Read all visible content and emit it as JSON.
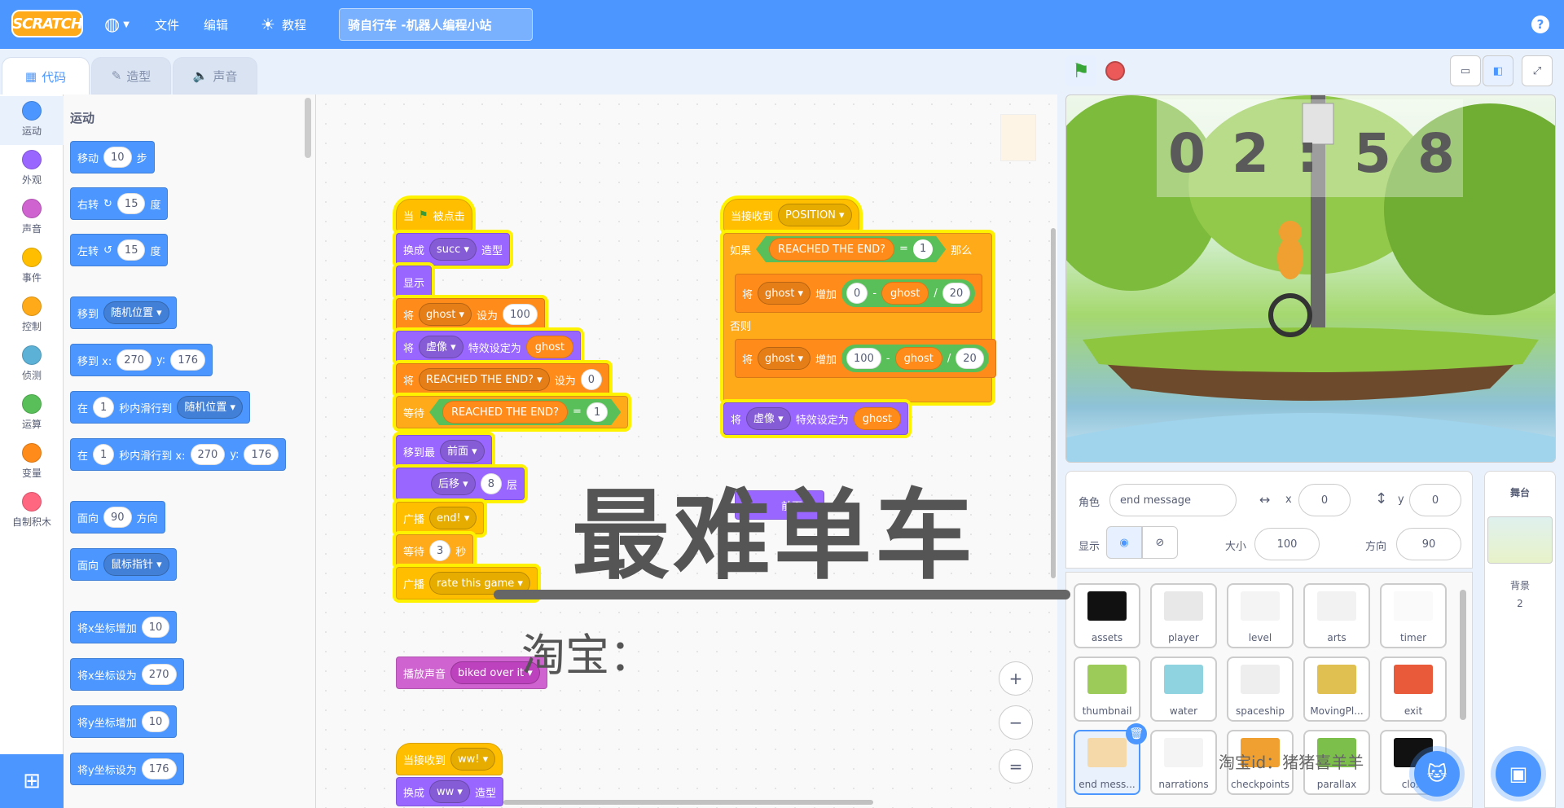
{
  "menubar": {
    "logo": "SCRATCH",
    "file": "文件",
    "edit": "编辑",
    "tutorials": "教程",
    "project_title": "骑自行车 -机器人编程小站",
    "help": "?"
  },
  "tabs": {
    "code": "代码",
    "costumes": "造型",
    "sounds": "声音"
  },
  "categories": [
    {
      "label": "运动",
      "color": "#4c97ff"
    },
    {
      "label": "外观",
      "color": "#9966ff"
    },
    {
      "label": "声音",
      "color": "#cf63cf"
    },
    {
      "label": "事件",
      "color": "#ffbf00"
    },
    {
      "label": "控制",
      "color": "#ffab19"
    },
    {
      "label": "侦测",
      "color": "#5cb1d6"
    },
    {
      "label": "运算",
      "color": "#59c059"
    },
    {
      "label": "变量",
      "color": "#ff8c1a"
    },
    {
      "label": "自制积木",
      "color": "#ff6680"
    }
  ],
  "palette": {
    "heading": "运动",
    "move": {
      "a": "移动",
      "v": "10",
      "b": "步"
    },
    "turn_right": {
      "a": "右转",
      "v": "15",
      "b": "度"
    },
    "turn_left": {
      "a": "左转",
      "v": "15",
      "b": "度"
    },
    "goto": {
      "a": "移到",
      "dd": "随机位置"
    },
    "goto_xy": {
      "a": "移到 x:",
      "x": "270",
      "b": "y:",
      "y": "176"
    },
    "glide": {
      "a": "在",
      "v": "1",
      "b": "秒内滑行到",
      "dd": "随机位置"
    },
    "glide_xy": {
      "a": "在",
      "v": "1",
      "b": "秒内滑行到 x:",
      "x": "270",
      "c": "y:",
      "y": "176"
    },
    "point_dir": {
      "a": "面向",
      "v": "90",
      "b": "方向"
    },
    "point_towards": {
      "a": "面向",
      "dd": "鼠标指针"
    },
    "change_x": {
      "a": "将x坐标增加",
      "v": "10"
    },
    "set_x": {
      "a": "将x坐标设为",
      "v": "270"
    },
    "change_y": {
      "a": "将y坐标增加",
      "v": "10"
    },
    "set_y": {
      "a": "将y坐标设为",
      "v": "176"
    }
  },
  "script1": {
    "hat_a": "当",
    "hat_b": "被点击",
    "switch_a": "换成",
    "switch_dd": "succ",
    "switch_b": "造型",
    "show": "显示",
    "set_a": "将",
    "set_dd": "ghost",
    "set_b": "设为",
    "set_v": "100",
    "effect_a": "将",
    "effect_dd": "虚像",
    "effect_b": "特效设定为",
    "effect_v": "ghost",
    "setvar_a": "将",
    "setvar_dd": "REACHED THE END?",
    "setvar_b": "设为",
    "setvar_v": "0",
    "wait_a": "等待",
    "wait_var": "REACHED THE END?",
    "wait_eq": "=",
    "wait_v": "1",
    "layer_a": "移到最",
    "layer_dd": "前面",
    "back_dd": "后移",
    "back_v": "8",
    "back_b": "层",
    "bc1_a": "广播",
    "bc1_dd": "end!",
    "wait2_a": "等待",
    "wait2_v": "3",
    "wait2_b": "秒",
    "bc2_a": "广播",
    "bc2_dd": "rate this game"
  },
  "script2": {
    "hat_a": "当接收到",
    "hat_dd": "POSITION",
    "if_a": "如果",
    "if_var": "REACHED THE END?",
    "if_eq": "=",
    "if_v": "1",
    "if_then": "那么",
    "c1_a": "将",
    "c1_dd": "ghost",
    "c1_b": "增加",
    "c1_x": "0",
    "c1_minus": "-",
    "c1_var": "ghost",
    "c1_div": "/",
    "c1_y": "20",
    "else": "否则",
    "c2_a": "将",
    "c2_dd": "ghost",
    "c2_b": "增加",
    "c2_x": "100",
    "c2_minus": "-",
    "c2_var": "ghost",
    "c2_div": "/",
    "c2_y": "20",
    "eff_a": "将",
    "eff_dd": "虚像",
    "eff_b": "特效设定为",
    "eff_v": "ghost"
  },
  "script3": {
    "a": "播放声音",
    "dd": "biked over it"
  },
  "script4": {
    "hat_a": "当接收到",
    "hat_dd": "ww!",
    "sw_a": "换成",
    "sw_dd": "ww",
    "sw_b": "造型"
  },
  "hidden_block": "前面",
  "watermark": {
    "big": "最难单车",
    "taobao": "淘宝：",
    "small": "淘宝id：猪猪喜羊羊"
  },
  "zoom": {
    "in": "+",
    "out": "−",
    "reset": "="
  },
  "stage": {
    "timer": [
      "0",
      "2",
      ":",
      "5",
      "8"
    ]
  },
  "sprite_info": {
    "sprite_label": "角色",
    "sprite_name": "end message",
    "x_label": "x",
    "x": "0",
    "y_label": "y",
    "y": "0",
    "show_label": "显示",
    "size_label": "大小",
    "size": "100",
    "dir_label": "方向",
    "dir": "90"
  },
  "sprites": [
    {
      "name": "assets",
      "color": "#111111"
    },
    {
      "name": "player",
      "color": "#e8e8e8"
    },
    {
      "name": "level",
      "color": "#f4f4f4"
    },
    {
      "name": "arts",
      "color": "#f2f2f2"
    },
    {
      "name": "timer",
      "color": "#fafafa"
    },
    {
      "name": "thumbnail",
      "color": "#9ccb5a"
    },
    {
      "name": "water",
      "color": "#8fd3e0"
    },
    {
      "name": "spaceship",
      "color": "#eeeeee"
    },
    {
      "name": "MovingPl...",
      "color": "#e0c050"
    },
    {
      "name": "exit",
      "color": "#e85a3a"
    },
    {
      "name": "end mess...",
      "color": "#f6d9a8"
    },
    {
      "name": "narrations",
      "color": "#f4f4f4"
    },
    {
      "name": "checkpoints",
      "color": "#f0a030"
    },
    {
      "name": "parallax",
      "color": "#7cbf4a"
    },
    {
      "name": "clo...",
      "color": "#111111"
    }
  ],
  "stage_panel": {
    "title": "舞台",
    "backdrop_label": "背景",
    "backdrop_count": "2"
  }
}
